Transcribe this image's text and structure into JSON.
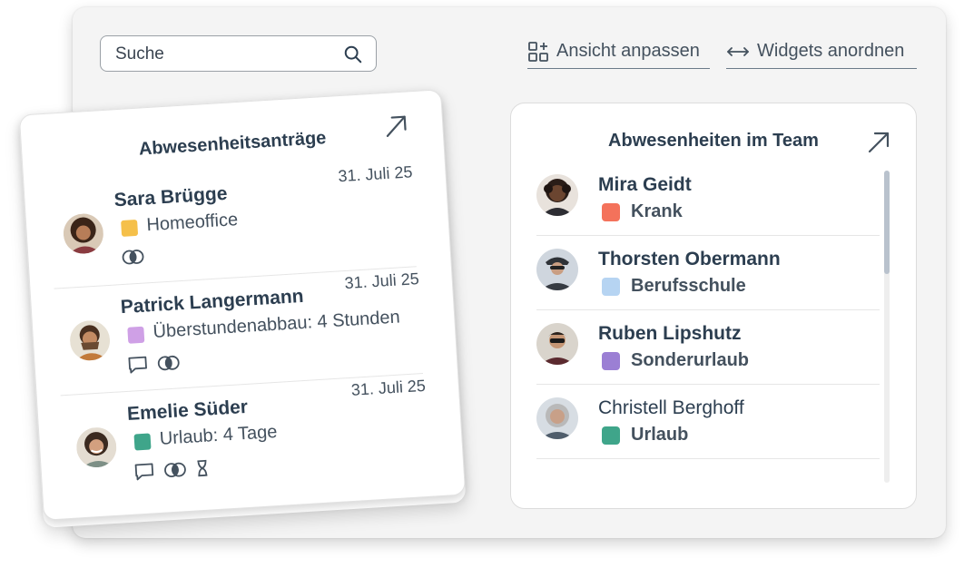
{
  "search": {
    "placeholder": "Suche"
  },
  "toolbar": {
    "customize_label": "Ansicht anpassen",
    "arrange_label": "Widgets anordnen"
  },
  "absence_requests": {
    "title": "Abwesenheitsanträge",
    "items": [
      {
        "name": "Sara Brügge",
        "date": "31. Juli 25",
        "type": "Homeoffice",
        "color": "#f5c04a",
        "icons": [
          "compare-icon"
        ]
      },
      {
        "name": "Patrick Langermann",
        "date": "31. Juli 25",
        "type": "Überstundenabbau: 4 Stunden",
        "color": "#cfa0e6",
        "icons": [
          "comment-icon",
          "compare-icon"
        ]
      },
      {
        "name": "Emelie Süder",
        "date": "31. Juli 25",
        "type": "Urlaub: 4 Tage",
        "color": "#3fa58a",
        "icons": [
          "comment-icon",
          "compare-icon",
          "hourglass-icon"
        ]
      }
    ]
  },
  "team_absences": {
    "title": "Abwesenheiten im Team",
    "items": [
      {
        "name": "Mira Geidt",
        "status": "Krank",
        "color": "#f4725b"
      },
      {
        "name": "Thorsten Obermann",
        "status": "Berufsschule",
        "color": "#b6d4f2"
      },
      {
        "name": "Ruben Lipshutz",
        "status": "Sonderurlaub",
        "color": "#9b7fd4"
      },
      {
        "name": "Christell Berghoff",
        "status": "Urlaub",
        "color": "#3fa58a"
      }
    ]
  }
}
